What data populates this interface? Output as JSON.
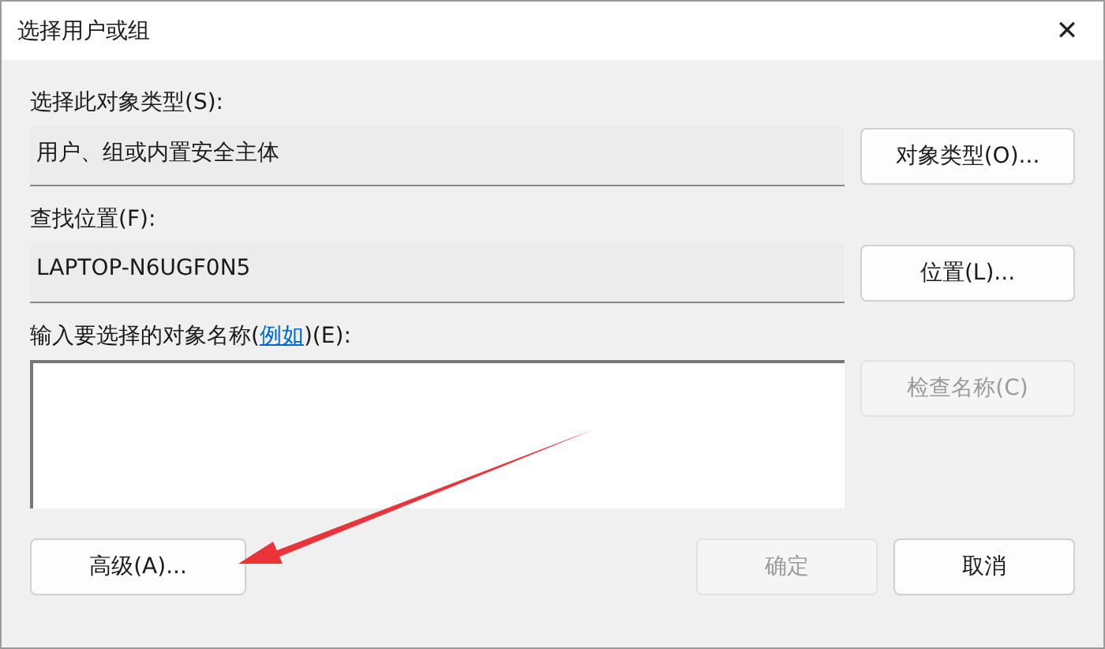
{
  "window": {
    "title": "选择用户或组",
    "close": "✕"
  },
  "object_type": {
    "label": "选择此对象类型(S):",
    "value": "用户、组或内置安全主体",
    "button": {
      "label": "对象类型(O)...",
      "disabled": false
    }
  },
  "location": {
    "label": "查找位置(F):",
    "value": "LAPTOP-N6UGF0N5",
    "button": {
      "label": "位置(L)...",
      "disabled": false
    }
  },
  "names": {
    "label_before": "输入要选择的对象名称(",
    "link": "例如",
    "label_after": ")(E):",
    "button": {
      "label": "检查名称(C)",
      "disabled": true
    }
  },
  "footer": [
    {
      "label": "高级(A)...",
      "disabled": false
    },
    {
      "label": "确定",
      "disabled": true
    },
    {
      "label": "取消",
      "disabled": false
    }
  ]
}
